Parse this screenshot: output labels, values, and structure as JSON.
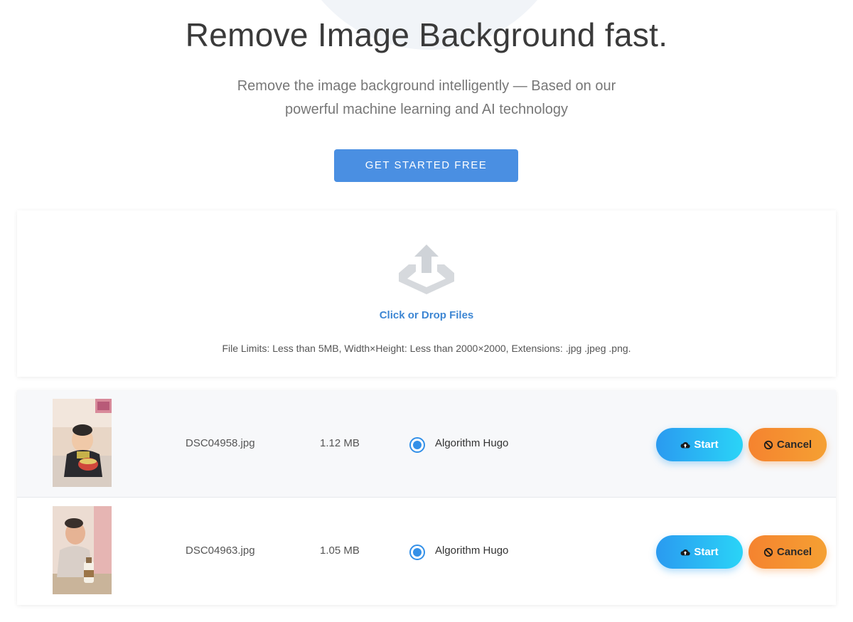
{
  "hero": {
    "title": "Remove Image Background fast.",
    "subtitle": "Remove the image background intelligently — Based on our powerful machine learning and AI technology",
    "cta_label": "GET STARTED FREE"
  },
  "upload": {
    "icon": "upload-icon",
    "link_text": "Click or Drop Files",
    "limits_text": "File Limits: Less than 5MB, Width×Height: Less than 2000×2000, Extensions: .jpg .jpeg .png."
  },
  "files": [
    {
      "name": "DSC04958.jpg",
      "size": "1.12 MB",
      "algorithm": "Algorithm Hugo",
      "algorithm_selected": true,
      "start_label": "Start",
      "cancel_label": "Cancel"
    },
    {
      "name": "DSC04963.jpg",
      "size": "1.05 MB",
      "algorithm": "Algorithm Hugo",
      "algorithm_selected": true,
      "start_label": "Start",
      "cancel_label": "Cancel"
    }
  ],
  "colors": {
    "accent": "#4a8fe2",
    "link": "#3d86d3",
    "start_gradient": [
      "#2a9af0",
      "#2ad4f7"
    ],
    "cancel_gradient": [
      "#f5832f",
      "#f5a033"
    ]
  }
}
